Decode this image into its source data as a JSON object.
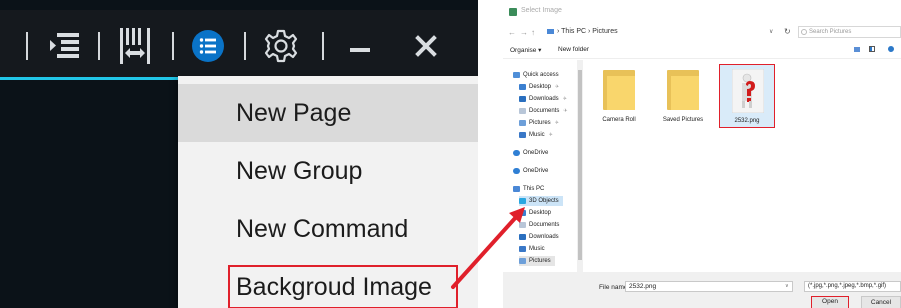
{
  "toolbar": {
    "icons": [
      "list-indent-icon",
      "columns-resize-icon",
      "menu-circle-icon",
      "gear-icon",
      "minimize-icon",
      "close-icon"
    ],
    "accent_color": "#21c6e8",
    "active_color": "#0a73c7"
  },
  "context_menu": {
    "items": [
      {
        "label": "New Page"
      },
      {
        "label": "New Group"
      },
      {
        "label": "New Command"
      },
      {
        "label": "Backgroud Image"
      }
    ]
  },
  "dialog": {
    "title": "Select Image",
    "breadcrumb": [
      "This PC",
      "Pictures"
    ],
    "search_placeholder": "Search Pictures",
    "organise_label": "Organise ▾",
    "new_folder_label": "New folder",
    "nav": [
      {
        "label": "Quick access",
        "icon": "star-icon"
      },
      {
        "label": "Desktop",
        "icon": "desktop-icon"
      },
      {
        "label": "Downloads",
        "icon": "download-icon"
      },
      {
        "label": "Documents",
        "icon": "document-icon"
      },
      {
        "label": "Pictures",
        "icon": "pictures-icon"
      },
      {
        "label": "Music",
        "icon": "music-icon"
      },
      {
        "label": "OneDrive",
        "icon": "cloud-icon"
      },
      {
        "label": "OneDrive",
        "icon": "cloud-icon"
      },
      {
        "label": "This PC",
        "icon": "pc-icon"
      },
      {
        "label": "3D Objects",
        "icon": "cube-icon"
      },
      {
        "label": "Desktop",
        "icon": "desktop-icon"
      },
      {
        "label": "Documents",
        "icon": "document-icon"
      },
      {
        "label": "Downloads",
        "icon": "download-icon"
      },
      {
        "label": "Music",
        "icon": "music-icon"
      },
      {
        "label": "Pictures",
        "icon": "pictures-icon"
      }
    ],
    "files": [
      {
        "name": "Camera Roll",
        "kind": "folder"
      },
      {
        "name": "Saved Pictures",
        "kind": "folder"
      },
      {
        "name": "2532.png",
        "kind": "image"
      }
    ],
    "filename_label": "File name:",
    "filename_value": "2532.png",
    "filetype_value": "(*.jpg,*.png,*.jpeg,*.bmp,*.gif)",
    "open_label": "Open",
    "cancel_label": "Cancel"
  },
  "highlight_color": "#e0202b"
}
